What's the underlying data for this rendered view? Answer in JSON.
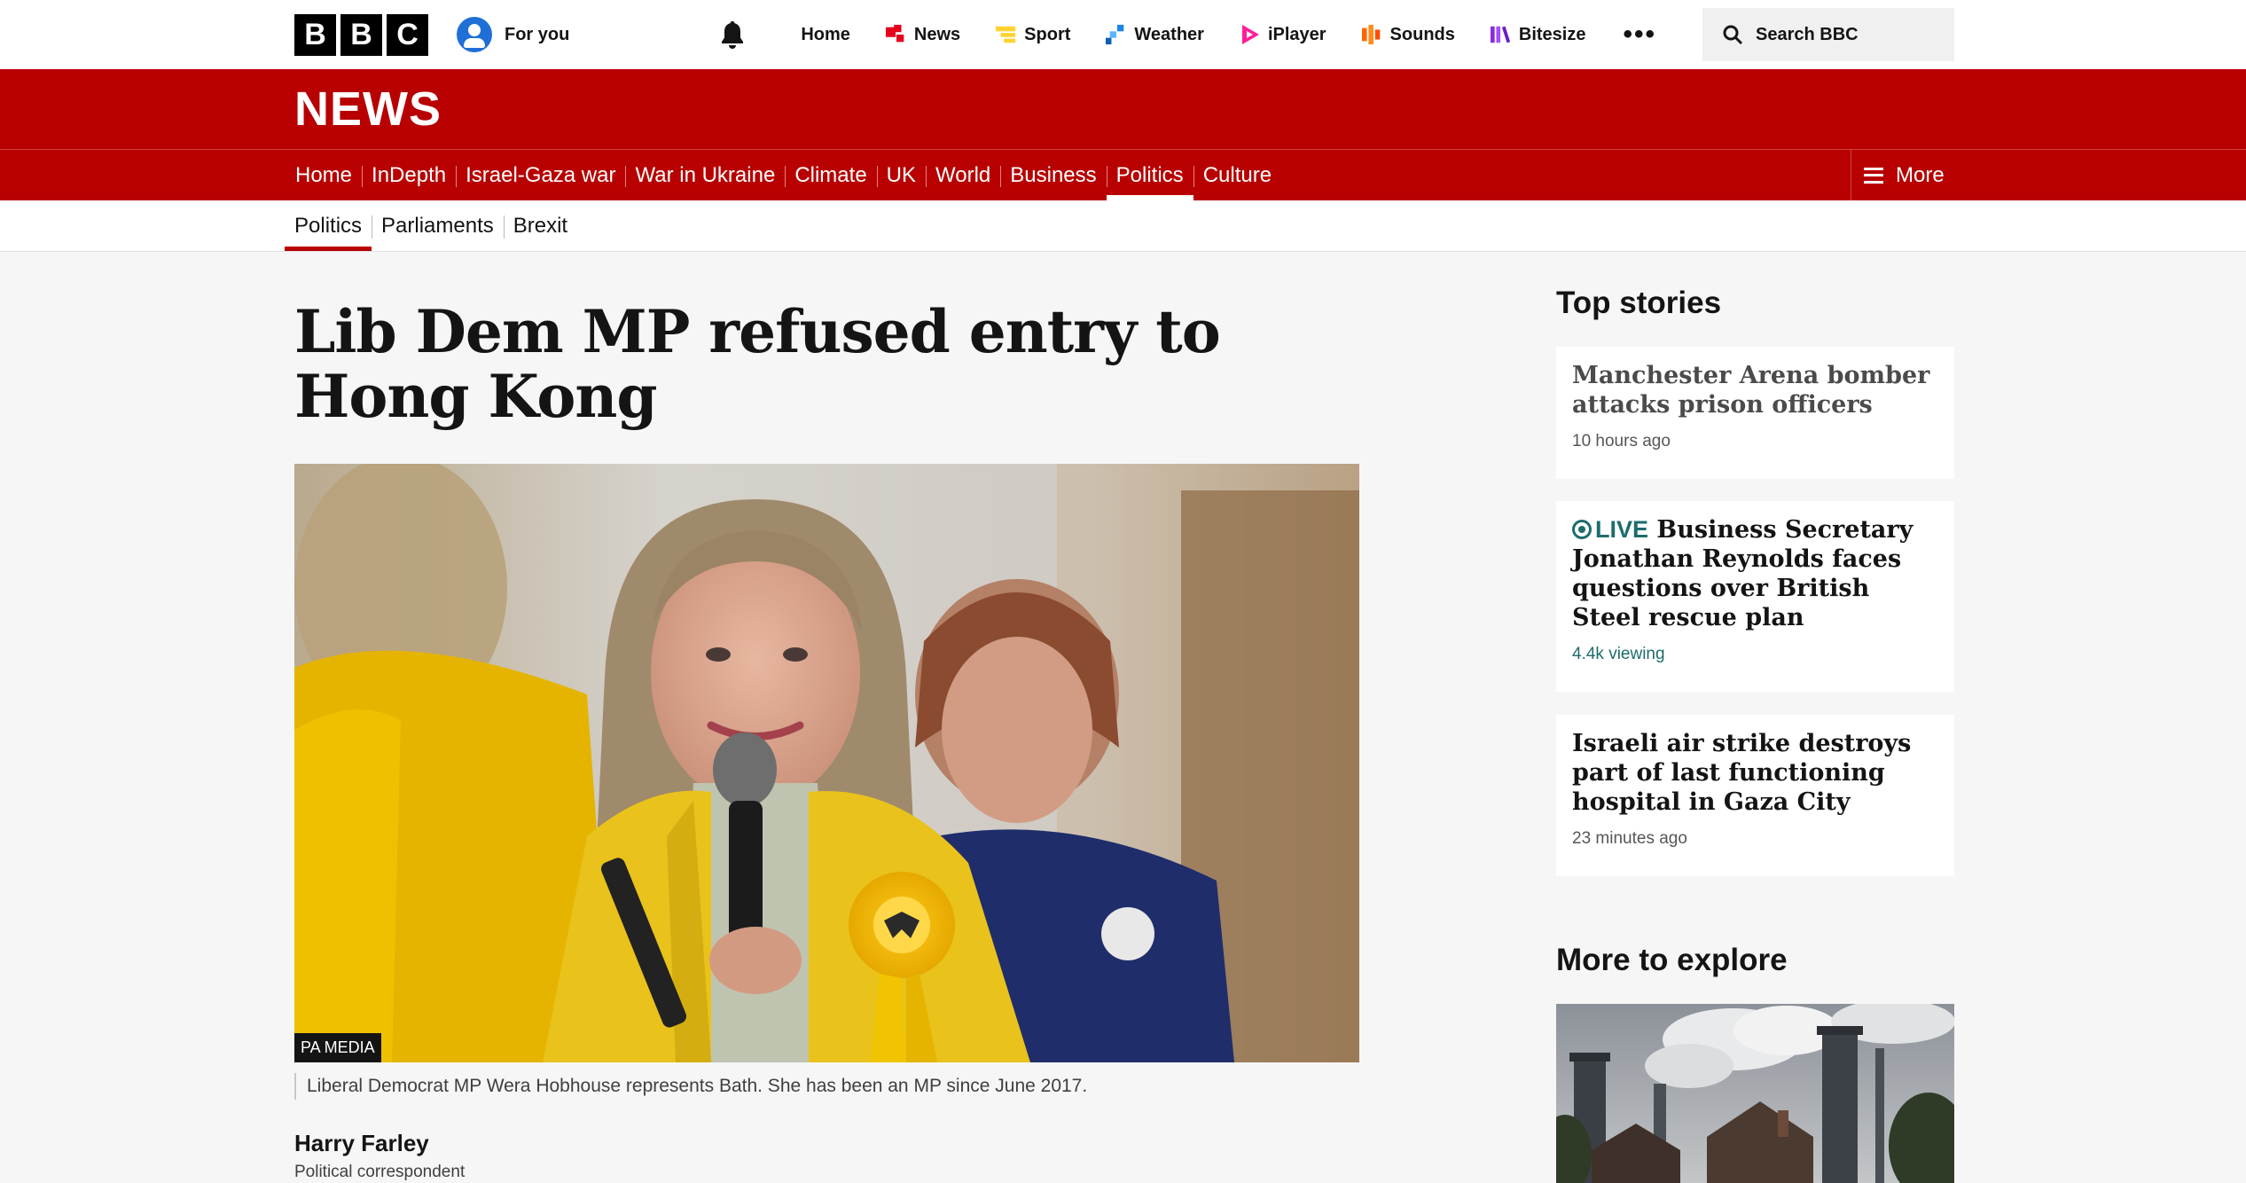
{
  "global_nav": {
    "logo_letters": [
      "B",
      "B",
      "C"
    ],
    "for_you": "For you",
    "items": [
      {
        "label": "Home",
        "icon": "none"
      },
      {
        "label": "News",
        "icon": "news-icon",
        "color": "#e6001e"
      },
      {
        "label": "Sport",
        "icon": "sport-icon",
        "color": "#ffd230"
      },
      {
        "label": "Weather",
        "icon": "weather-icon",
        "color": "#1d84e2"
      },
      {
        "label": "iPlayer",
        "icon": "iplayer-icon",
        "color": "#ff1e9a"
      },
      {
        "label": "Sounds",
        "icon": "sounds-icon",
        "color": "#ff6600"
      },
      {
        "label": "Bitesize",
        "icon": "bitesize-icon",
        "color": "#8a2be2"
      }
    ],
    "more": "•••",
    "search_label": "Search BBC"
  },
  "masthead": {
    "title": "NEWS"
  },
  "section_nav": {
    "items": [
      "Home",
      "InDepth",
      "Israel-Gaza war",
      "War in Ukraine",
      "Climate",
      "UK",
      "World",
      "Business",
      "Politics",
      "Culture"
    ],
    "active": "Politics",
    "more_label": "More"
  },
  "sub_nav": {
    "items": [
      "Politics",
      "Parliaments",
      "Brexit"
    ],
    "active": "Politics"
  },
  "article": {
    "headline": "Lib Dem MP refused entry to Hong Kong",
    "image_credit": "PA MEDIA",
    "caption": "Liberal Democrat MP Wera Hobhouse represents Bath. She has been an MP since June 2017.",
    "author": "Harry Farley",
    "author_role": "Political correspondent"
  },
  "sidebar": {
    "top_stories_heading": "Top stories",
    "stories": [
      {
        "title": "Manchester Arena bomber attacks prison officers",
        "meta": "10 hours ago",
        "live": false
      },
      {
        "title": "Business Secretary Jonathan Reynolds faces questions over British Steel rescue plan",
        "meta": "4.4k viewing",
        "live": true,
        "live_label": "LIVE"
      },
      {
        "title": "Israeli air strike destroys part of last functioning hospital in Gaza City",
        "meta": "23 minutes ago",
        "live": false
      }
    ],
    "more_heading": "More to explore"
  },
  "colors": {
    "brand_red": "#b80000",
    "live_teal": "#1e6c6c",
    "libdem_yellow": "#f0c400"
  }
}
